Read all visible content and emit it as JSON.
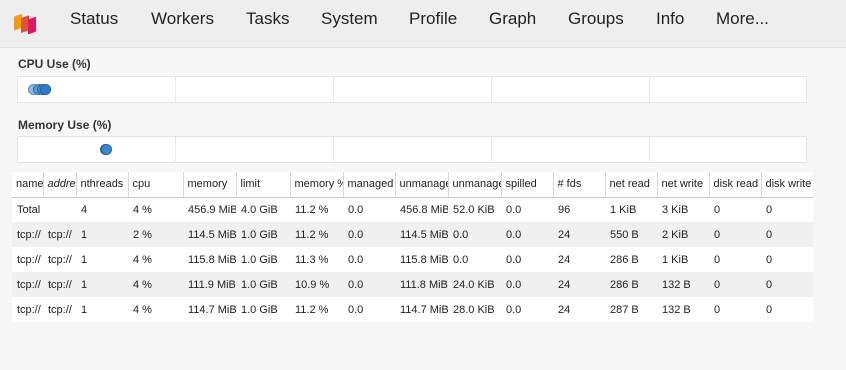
{
  "nav": {
    "items": [
      "Status",
      "Workers",
      "Tasks",
      "System",
      "Profile",
      "Graph",
      "Groups",
      "Info",
      "More..."
    ]
  },
  "logo": {
    "colors": [
      "#f39c12",
      "#e74c3c",
      "#d81b60"
    ]
  },
  "cpu": {
    "title": "CPU Use (%)"
  },
  "memory": {
    "title": "Memory Use (%)"
  },
  "table": {
    "columns": [
      "name",
      "address",
      "nthreads",
      "cpu",
      "memory",
      "limit",
      "memory %",
      "managed",
      "unmanaged",
      "unmanaged recent",
      "spilled",
      "# fds",
      "net read",
      "net write",
      "disk read",
      "disk write"
    ],
    "rows": [
      [
        "Total",
        "",
        "4",
        "4 %",
        "456.9 MiB",
        "4.0 GiB",
        "11.2 %",
        "0.0",
        "456.8 MiB",
        "52.0 KiB",
        "0.0",
        "96",
        "1 KiB",
        "3 KiB",
        "0",
        "0"
      ],
      [
        "tcp://",
        "tcp://",
        "1",
        "2 %",
        "114.5 MiB",
        "1.0 GiB",
        "11.2 %",
        "0.0",
        "114.5 MiB",
        "0.0",
        "0.0",
        "24",
        "550 B",
        "2 KiB",
        "0",
        "0"
      ],
      [
        "tcp://",
        "tcp://",
        "1",
        "4 %",
        "115.8 MiB",
        "1.0 GiB",
        "11.3 %",
        "0.0",
        "115.8 MiB",
        "0.0",
        "0.0",
        "24",
        "286 B",
        "1 KiB",
        "0",
        "0"
      ],
      [
        "tcp://",
        "tcp://",
        "1",
        "4 %",
        "111.9 MiB",
        "1.0 GiB",
        "10.9 %",
        "0.0",
        "111.8 MiB",
        "24.0 KiB",
        "0.0",
        "24",
        "286 B",
        "132 B",
        "0",
        "0"
      ],
      [
        "tcp://",
        "tcp://",
        "1",
        "4 %",
        "114.7 MiB",
        "1.0 GiB",
        "11.2 %",
        "0.0",
        "114.7 MiB",
        "28.0 KiB",
        "0.0",
        "24",
        "287 B",
        "132 B",
        "0",
        "0"
      ]
    ]
  }
}
